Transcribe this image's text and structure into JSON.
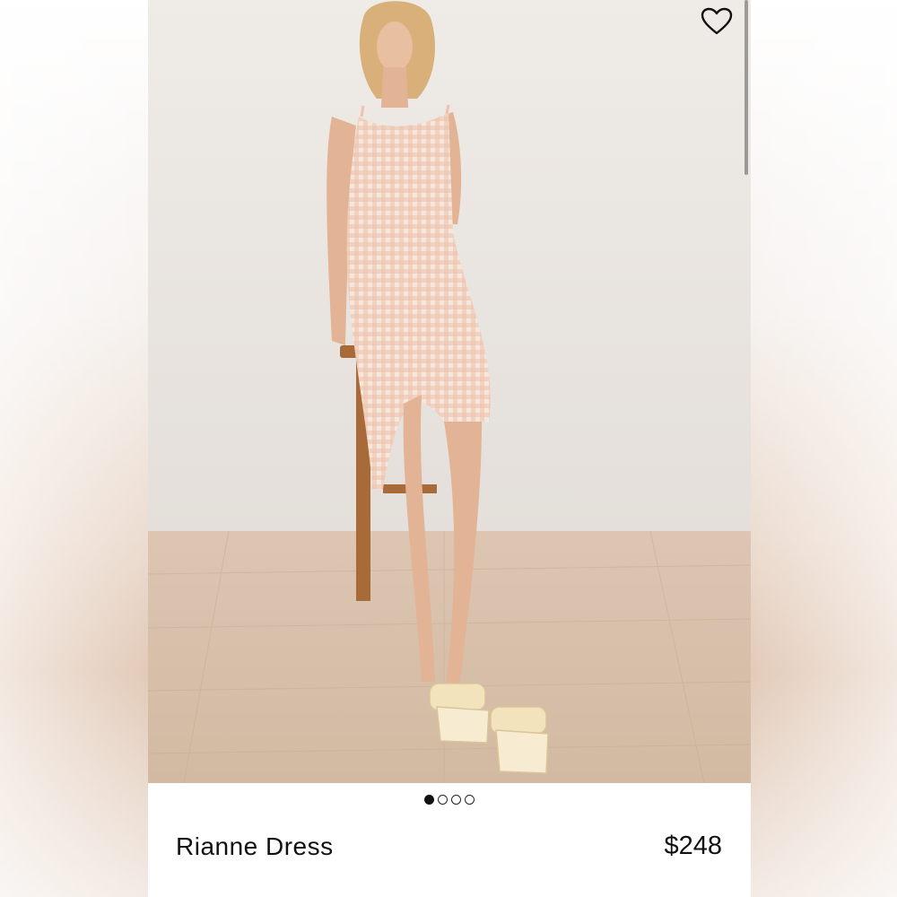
{
  "product": {
    "name": "Rianne Dress",
    "price": "$248"
  },
  "gallery": {
    "image_count": 4,
    "active_index": 0
  },
  "icons": {
    "favorite": "heart-outline-icon"
  },
  "colors": {
    "text": "#111111",
    "background": "#ffffff",
    "dot_active": "#111111"
  }
}
